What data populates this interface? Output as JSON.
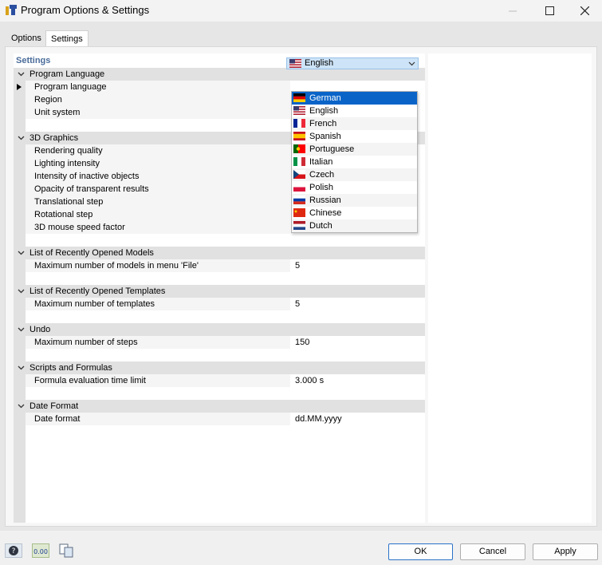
{
  "window": {
    "title": "Program Options & Settings"
  },
  "tabs": [
    {
      "label": "Options"
    },
    {
      "label": "Settings"
    }
  ],
  "tree": {
    "header": "Settings",
    "categories": [
      {
        "label": "Program Language",
        "rows": [
          {
            "name": "Program language",
            "value": "English"
          },
          {
            "name": "Region",
            "value": ""
          },
          {
            "name": "Unit system",
            "value": ""
          }
        ]
      },
      {
        "label": "3D Graphics",
        "rows": [
          {
            "name": "Rendering quality",
            "value": ""
          },
          {
            "name": "Lighting intensity",
            "value": ""
          },
          {
            "name": "Intensity of inactive objects",
            "value": ""
          },
          {
            "name": "Opacity of transparent results",
            "value": ""
          },
          {
            "name": "Translational step",
            "value": ""
          },
          {
            "name": "Rotational step",
            "value": ""
          },
          {
            "name": "3D mouse speed factor",
            "value": ""
          }
        ]
      },
      {
        "label": "List of Recently Opened Models",
        "rows": [
          {
            "name": "Maximum number of models in menu 'File'",
            "value": "5"
          }
        ]
      },
      {
        "label": "List of Recently Opened Templates",
        "rows": [
          {
            "name": "Maximum number of templates",
            "value": "5"
          }
        ]
      },
      {
        "label": "Undo",
        "rows": [
          {
            "name": "Maximum number of steps",
            "value": "150"
          }
        ]
      },
      {
        "label": "Scripts and Formulas",
        "rows": [
          {
            "name": "Formula evaluation time limit",
            "value": "3.000 s"
          }
        ]
      },
      {
        "label": "Date Format",
        "rows": [
          {
            "name": "Date format",
            "value": "dd.MM.yyyy"
          }
        ]
      }
    ]
  },
  "language_combo": {
    "value": "English",
    "flag": "us"
  },
  "language_dropdown": {
    "selected": "German",
    "items": [
      {
        "label": "German",
        "flag": "de"
      },
      {
        "label": "English",
        "flag": "us"
      },
      {
        "label": "French",
        "flag": "fr"
      },
      {
        "label": "Spanish",
        "flag": "es"
      },
      {
        "label": "Portuguese",
        "flag": "pt"
      },
      {
        "label": "Italian",
        "flag": "it"
      },
      {
        "label": "Czech",
        "flag": "cz"
      },
      {
        "label": "Polish",
        "flag": "pl"
      },
      {
        "label": "Russian",
        "flag": "ru"
      },
      {
        "label": "Chinese",
        "flag": "cn"
      },
      {
        "label": "Dutch",
        "flag": "nl"
      }
    ]
  },
  "footer": {
    "icons": [
      "help-icon",
      "units-icon",
      "copy-settings-icon"
    ],
    "units_icon_text": "0.00",
    "buttons": {
      "ok": "OK",
      "cancel": "Cancel",
      "apply": "Apply"
    }
  },
  "colors": {
    "selection": "#0a64c8",
    "header_text": "#4a6c9a",
    "category_bg": "#e1e1e1"
  }
}
